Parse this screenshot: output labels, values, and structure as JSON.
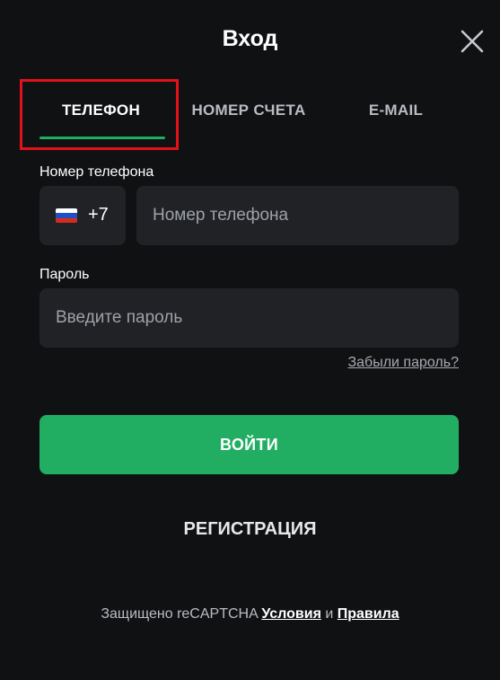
{
  "modal": {
    "title": "Вход",
    "close_icon": "close-icon"
  },
  "tabs": [
    {
      "label": "ТЕЛЕФОН",
      "active": true
    },
    {
      "label": "НОМЕР СЧЕТА",
      "active": false
    },
    {
      "label": "E-MAIL",
      "active": false
    }
  ],
  "phone": {
    "label": "Номер телефона",
    "country_flag": "russia-flag-icon",
    "country_code": "+7",
    "value": "",
    "placeholder": "Номер телефона"
  },
  "password": {
    "label": "Пароль",
    "value": "",
    "placeholder": "Введите пароль"
  },
  "forgot_link": "Забыли пароль?",
  "login_button": "ВОЙТИ",
  "register_button": "РЕГИСТРАЦИЯ",
  "footer": {
    "text_prefix": "Защищено reCAPTCHA",
    "terms_link": "Условия",
    "conjunction": "и",
    "rules_link": "Правила"
  },
  "colors": {
    "background": "#101113",
    "field_bg": "#202226",
    "accent_green": "#21ae63",
    "highlight_red": "#e3111b"
  }
}
